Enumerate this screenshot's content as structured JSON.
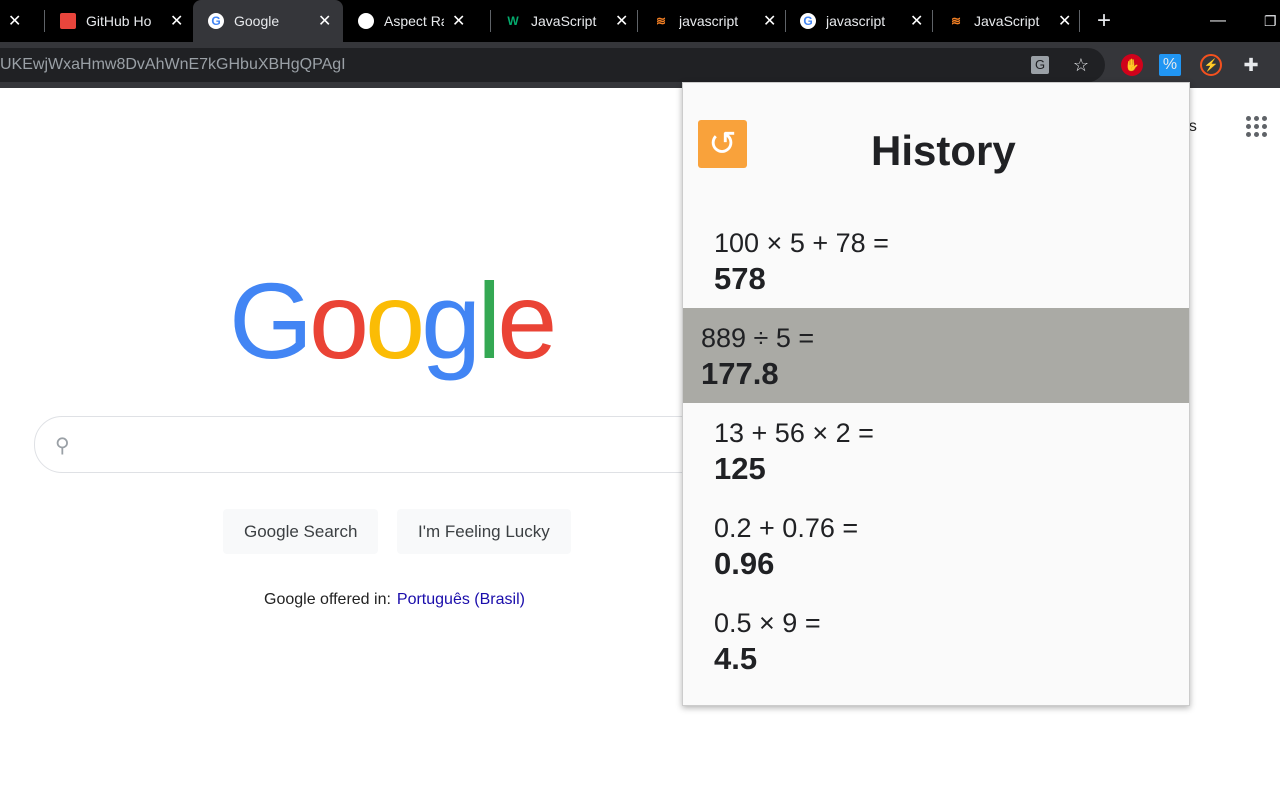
{
  "tabs": [
    {
      "label": "",
      "icon": "partial-tab"
    },
    {
      "label": "GitHub Ho",
      "icon": "chrome-web-store-icon"
    },
    {
      "label": "Google",
      "icon": "google-icon",
      "active": true
    },
    {
      "label": "Aspect Ra",
      "icon": "globe-icon"
    },
    {
      "label": "JavaScript",
      "icon": "w3schools-icon"
    },
    {
      "label": "javascript",
      "icon": "stackoverflow-icon"
    },
    {
      "label": "javascript",
      "icon": "google-icon"
    },
    {
      "label": "JavaScript",
      "icon": "stackoverflow-icon"
    }
  ],
  "url": "UKEwjWxaHmw8DvAhWnE7kGHbuXBHgQPAgI",
  "google": {
    "logo": "Google",
    "search_btn": "Google Search",
    "lucky_btn": "I'm Feeling Lucky",
    "offered": "Google offered in:",
    "language": "Português (Brasil)",
    "images": "es"
  },
  "popup": {
    "title": "History",
    "accent": "#f9a23b",
    "selected_bg": "#aaaaa5",
    "items": [
      {
        "expr": "100 × 5 + 78 =",
        "result": "578"
      },
      {
        "expr": "889 ÷ 5 =",
        "result": "177.8"
      },
      {
        "expr": "13 + 56 × 2 =",
        "result": "125"
      },
      {
        "expr": "0.2 + 0.76 =",
        "result": "0.96"
      },
      {
        "expr": "0.5 × 9 =",
        "result": "4.5"
      }
    ]
  }
}
